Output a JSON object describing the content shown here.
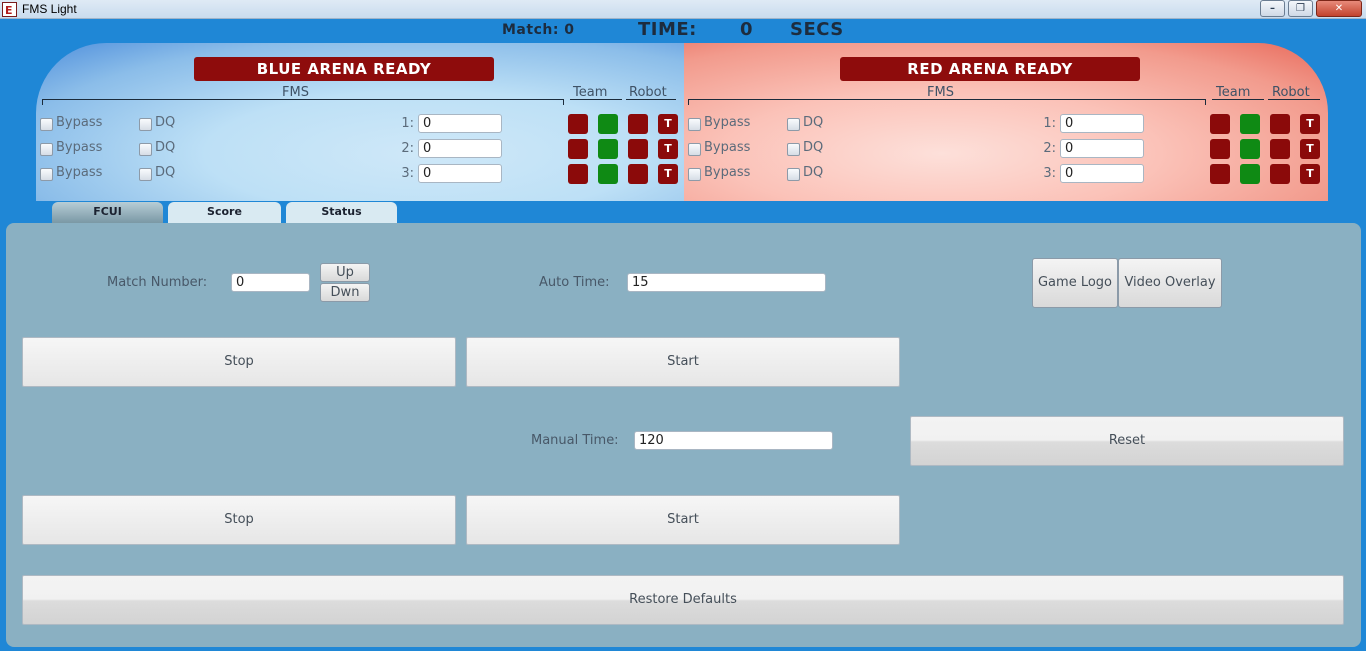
{
  "window": {
    "title": "FMS Light",
    "icon_letter": "E",
    "controls": [
      "minimize",
      "maximize",
      "close"
    ]
  },
  "header": {
    "match_label": "Match: 0",
    "time_label": "TIME:",
    "time_value": "0",
    "time_unit": "SECS"
  },
  "blue": {
    "banner": "BLUE ARENA READY",
    "fms_label": "FMS",
    "team_label": "Team",
    "robot_label": "Robot",
    "stations": [
      {
        "bypass": "Bypass",
        "dq": "DQ",
        "num": "1:",
        "value": "0",
        "t": "T"
      },
      {
        "bypass": "Bypass",
        "dq": "DQ",
        "num": "2:",
        "value": "0",
        "t": "T"
      },
      {
        "bypass": "Bypass",
        "dq": "DQ",
        "num": "3:",
        "value": "0",
        "t": "T"
      }
    ]
  },
  "red": {
    "banner": "RED ARENA READY",
    "fms_label": "FMS",
    "team_label": "Team",
    "robot_label": "Robot",
    "stations": [
      {
        "bypass": "Bypass",
        "dq": "DQ",
        "num": "1:",
        "value": "0",
        "t": "T"
      },
      {
        "bypass": "Bypass",
        "dq": "DQ",
        "num": "2:",
        "value": "0",
        "t": "T"
      },
      {
        "bypass": "Bypass",
        "dq": "DQ",
        "num": "3:",
        "value": "0",
        "t": "T"
      }
    ]
  },
  "tabs": [
    {
      "label": "FCUI",
      "active": false
    },
    {
      "label": "Score",
      "active": true
    },
    {
      "label": "Status",
      "active": false
    }
  ],
  "controls": {
    "match_number_label": "Match Number:",
    "match_number_value": "0",
    "up_label": "Up",
    "dwn_label": "Dwn",
    "auto_time_label": "Auto Time:",
    "auto_time_value": "15",
    "game_logo_label": "Game Logo",
    "video_overlay_label": "Video Overlay",
    "auto_stop_label": "Stop",
    "auto_start_label": "Start",
    "manual_time_label": "Manual Time:",
    "manual_time_value": "120",
    "reset_label": "Reset",
    "manual_stop_label": "Stop",
    "manual_start_label": "Start",
    "restore_defaults_label": "Restore Defaults"
  },
  "colors": {
    "panel": "#8ab0c2",
    "banner": "#8e0c0c",
    "indicator_red": "#8b0a0a",
    "indicator_green": "#0f8a14",
    "window_bg": "#1f87d6"
  }
}
